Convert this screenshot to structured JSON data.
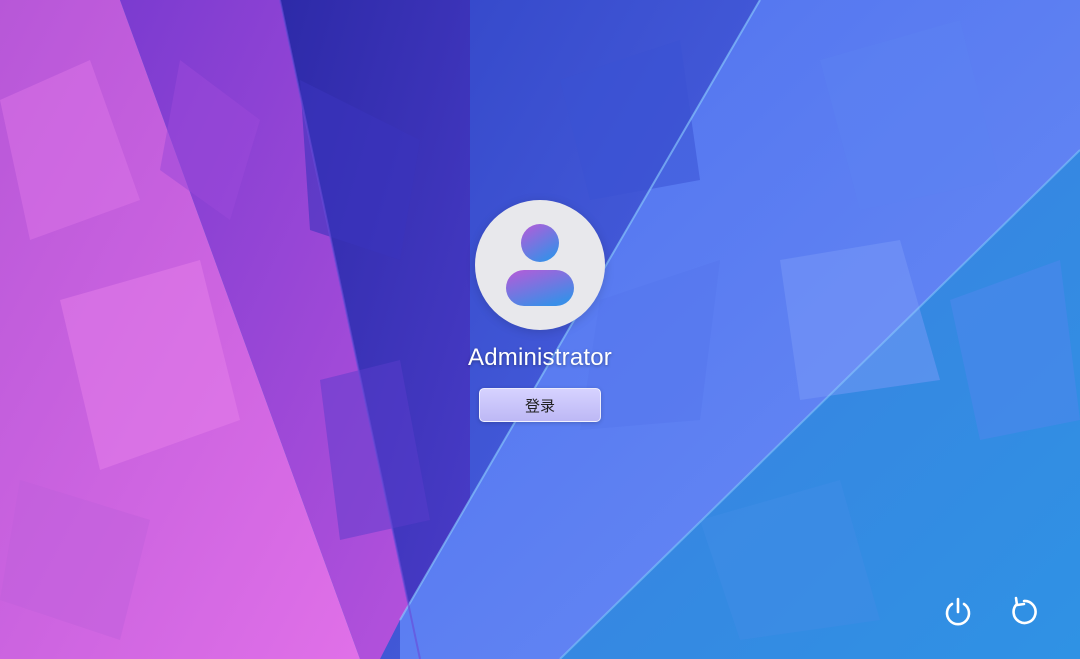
{
  "login": {
    "username": "Administrator",
    "login_label": "登录"
  },
  "icons": {
    "avatar": "user-avatar-icon",
    "power": "power-icon",
    "restart": "restart-icon"
  },
  "colors": {
    "avatar_head_top": "#b85ad8",
    "avatar_body_bottom": "#3a8ee8",
    "button_fill": "#c9c5fb",
    "icon_color": "#ffffff"
  }
}
